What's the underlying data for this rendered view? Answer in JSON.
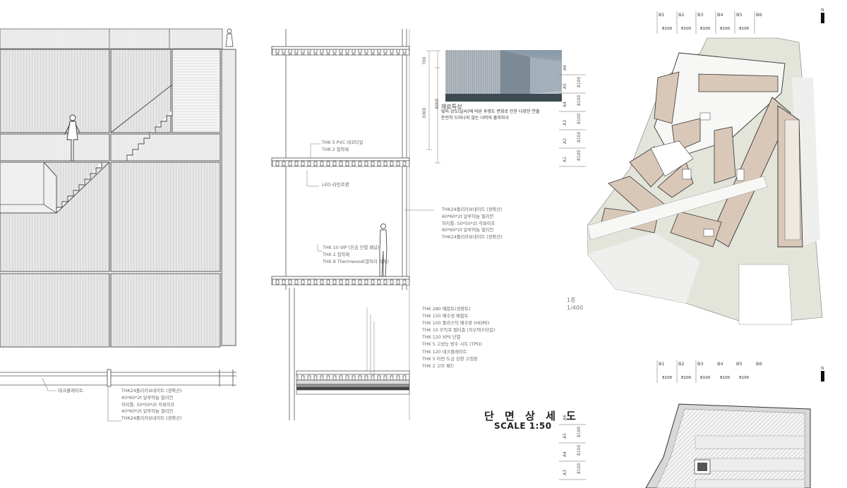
{
  "left_section": {
    "bottom_label": "데크플레이트",
    "labels": [
      "THK24폴리카보네이트 (광확산)",
      "40*60*2t 알루미늄 멀리언",
      "하지틀: 50*50*2t 각파이프",
      "40*60*2t 알루미늄 멀리언",
      "THK24폴리카보네이트 (광확산)"
    ]
  },
  "middle_section": {
    "dimensions": [
      "700",
      "4000",
      "3300"
    ],
    "material_title": "재료특성",
    "material_desc": [
      "빛의 강도(날씨)에 따른 투명도 변화로 인한 다양한 연출",
      "온전히 드러나지 않는 너머의 흥미자극"
    ],
    "upper_labels": [
      "THK 5 PVC 데코타일",
      "THK 2  접착제"
    ],
    "led_label": "LED 라인조명",
    "wall_labels": [
      "THK24폴리카보네이트 (광확산)",
      "60*60*2t 알루미늄 멀리언",
      "하지틀: 50*50*2t 각파이프",
      "60*60*2t 알루미늄 멀리언",
      "THK24폴리카보네이트 (광확산)"
    ],
    "floor_labels": [
      "THK 10 VIP (진공 단열 패널)",
      "THK 2  접착제",
      "THK 8 Thermwood(열처리 목재)"
    ],
    "roof_labels": [
      "THK 280 배합토(경량토)",
      "THK 150 배수성 배합토",
      "THK 100 플라스틱 배수판 (HDPE)",
      "THK 10   부직포 필터층 (지오텍스타일)",
      "THK 120 XPS 단열",
      "THK 5    고성능 방수 시트 (TPO)",
      "THK 120 데크플레이트",
      "THK 5    아연 도금 강판 고정판",
      "THK 2    고무 패드"
    ],
    "title_ko": "단 면 상 세 도",
    "title_en": "SCALE 1:50"
  },
  "plan_top": {
    "col_grid": [
      "B1",
      "B2",
      "B3",
      "B4",
      "B5",
      "B6"
    ],
    "col_dims": [
      "8100",
      "8100",
      "8100",
      "8100",
      "8100"
    ],
    "row_grid": [
      "A6",
      "A5",
      "A4",
      "A3",
      "A2",
      "A1"
    ],
    "row_dims": [
      "8100",
      "8100",
      "8100",
      "8100",
      "8100"
    ],
    "north": "N",
    "floor": "1층",
    "scale": "1/400"
  },
  "plan_bottom": {
    "col_grid": [
      "B1",
      "B2",
      "B3",
      "B4",
      "B5",
      "B6"
    ],
    "col_dims": [
      "8100",
      "8100",
      "8100",
      "8100",
      "8100"
    ],
    "row_grid": [
      "A6",
      "A5",
      "A4",
      "A3"
    ],
    "row_dims": [
      "8100",
      "8100",
      "8100"
    ],
    "north": "N"
  },
  "colors": {
    "room_fill": "#d9c8b8",
    "site_fill": "#e2e4da",
    "line": "#444444"
  }
}
